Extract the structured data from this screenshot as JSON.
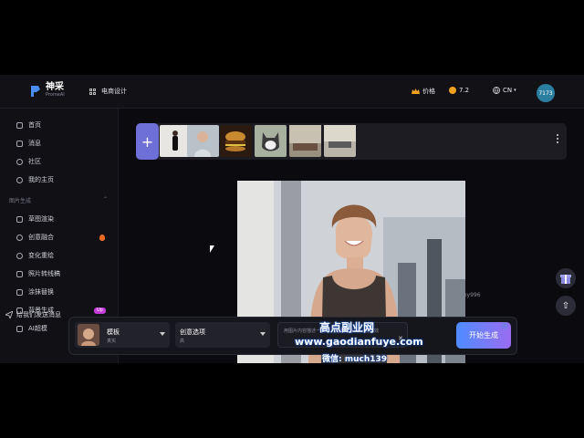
{
  "header": {
    "logo_name": "神采",
    "logo_sub": "PromeAI",
    "tool_label": "电商设计",
    "price_label": "价格",
    "coins": "7.2",
    "language": "CN",
    "avatar_text": "7173"
  },
  "sidebar": {
    "items": [
      {
        "label": "首页",
        "icon": "home-icon"
      },
      {
        "label": "消息",
        "icon": "bell-icon"
      },
      {
        "label": "社区",
        "icon": "compass-icon"
      },
      {
        "label": "我的主页",
        "icon": "user-icon"
      }
    ],
    "section_title": "图片生成",
    "gen_items": [
      {
        "label": "草图渲染",
        "icon": "brush-icon"
      },
      {
        "label": "创意融合",
        "icon": "blend-icon"
      },
      {
        "label": "变化重绘",
        "icon": "refresh-icon"
      },
      {
        "label": "照片转线稿",
        "icon": "edit-icon"
      },
      {
        "label": "涂抹替换",
        "icon": "eraser-icon"
      },
      {
        "label": "背景生成",
        "icon": "image-icon"
      },
      {
        "label": "AI超模",
        "icon": "model-icon"
      }
    ],
    "badge_up": "Up",
    "feedback_label": "给我们发送消息"
  },
  "strip": {
    "add_symbol": "+",
    "thumbs": [
      "thumb-person-black-dress",
      "thumb-woman-portrait",
      "thumb-burger",
      "thumb-husky-dog",
      "thumb-interior-room",
      "thumb-interior-living"
    ]
  },
  "generator": {
    "template_label": "模板",
    "template_sub": "真实",
    "option_label": "创意选项",
    "option_sub": "高",
    "prompt_placeholder": "用图片内容描述一张... 大约10个字... 一般高效",
    "generate_label": "开始生成"
  },
  "watermark": {
    "line1": "高点副业网",
    "line2": "www.gaodianfuye.com",
    "line3": "微信: much139",
    "small": "xy996"
  },
  "colors": {
    "accent": "#6f6fd8",
    "avatar": "#2a7fa0"
  }
}
